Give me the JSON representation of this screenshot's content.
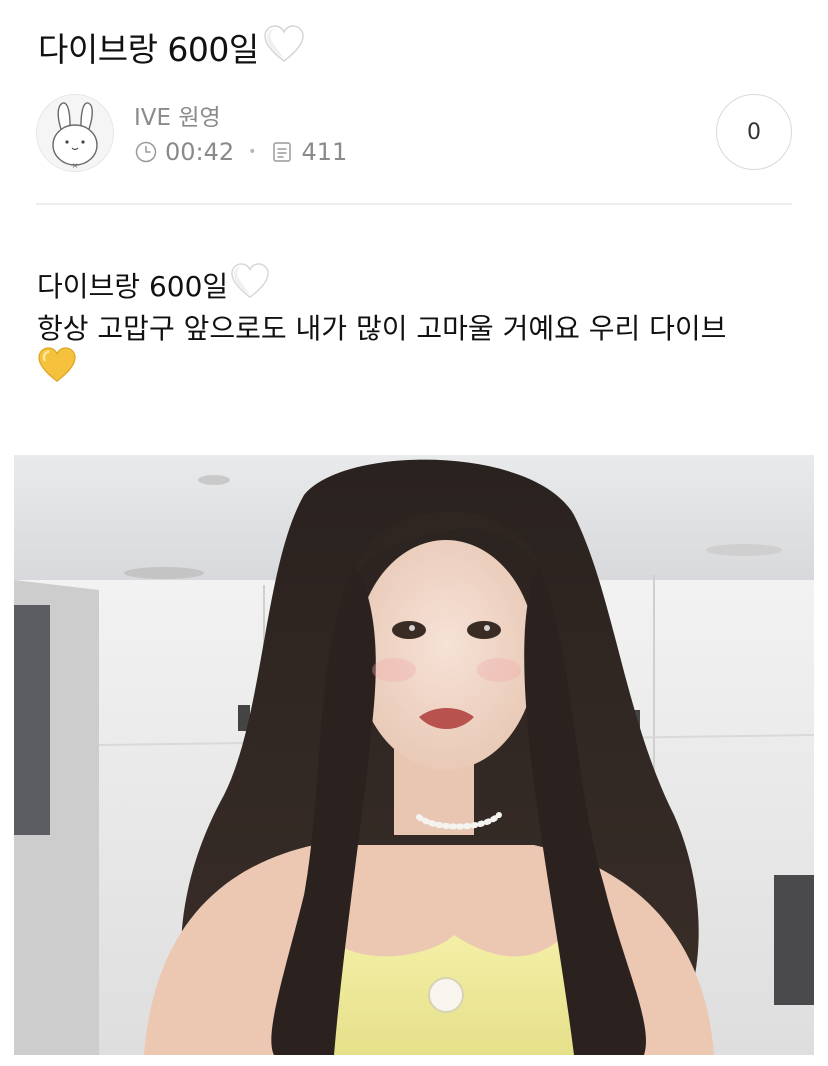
{
  "post": {
    "title": "다이브랑 600일",
    "title_emoji": "white-heart-icon"
  },
  "author": {
    "name": "IVE 원영",
    "avatar": "bunny-avatar-icon",
    "time": "00:42",
    "time_icon": "clock-icon",
    "views": "411",
    "views_icon": "document-icon"
  },
  "comments": {
    "count": "0"
  },
  "body": {
    "line1": "다이브랑 600일",
    "line1_emoji": "white-heart-icon",
    "line2": "항상 고맙구 앞으로도 내가 많이 고마울 거예요 우리 다이브",
    "line3_emoji": "yellow-heart-icon"
  },
  "photo": {
    "description_icon": "selfie-photo"
  },
  "colors": {
    "text": "#111111",
    "muted": "#8a8a8a",
    "divider": "#ececec",
    "yellow_heart": "#f6c23e",
    "white_heart": "#ffffff"
  }
}
